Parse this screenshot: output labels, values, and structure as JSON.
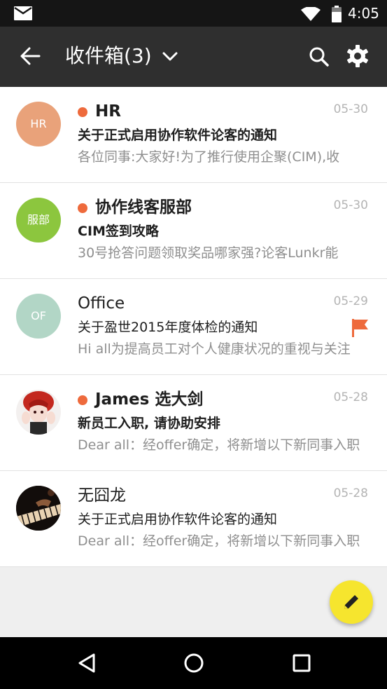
{
  "status_bar": {
    "time": "4:05",
    "icons": [
      "mail-icon",
      "wifi-icon",
      "battery-icon"
    ]
  },
  "app_bar": {
    "title": "收件箱(3)",
    "icons": [
      "back-arrow-icon",
      "chevron-down-icon",
      "search-icon",
      "gear-icon"
    ]
  },
  "emails": [
    {
      "avatar_text": "HR",
      "avatar_color": "#e9a27a",
      "unread": true,
      "sender": "HR",
      "date": "05-30",
      "subject": "关于正式启用协作软件论客的通知",
      "preview": "各位同事:大家好!为了推行使用企聚(CIM),收",
      "flagged": false
    },
    {
      "avatar_text": "服部",
      "avatar_color": "#8cc63e",
      "unread": true,
      "sender": "协作线客服部",
      "date": "05-30",
      "subject": "CIM签到攻略",
      "preview": "30号抢答问题领取奖品哪家强?论客Lunkr能",
      "flagged": false
    },
    {
      "avatar_text": "OF",
      "avatar_color": "#b2d6c6",
      "unread": false,
      "sender": "Office",
      "date": "05-29",
      "subject": "关于盈世2015年度体检的通知",
      "preview": "Hi all为提高员工对个人健康状况的重视与关注",
      "flagged": true,
      "flag_color": "#ee6a3c"
    },
    {
      "avatar_text": "",
      "avatar_image": "anime-character-photo",
      "unread": true,
      "sender": "James 选大剑",
      "date": "05-28",
      "subject": "新员工入职, 请协助安排",
      "preview": "Dear all：经offer确定，将新增以下新同事入职",
      "flagged": false
    },
    {
      "avatar_text": "",
      "avatar_image": "piano-photo",
      "unread": false,
      "sender": "无囧龙",
      "date": "05-28",
      "subject": "关于正式启用协作软件论客的通知",
      "preview": "Dear all：经offer确定，将新增以下新同事入职",
      "flagged": false
    }
  ],
  "fab": {
    "icon": "pencil-icon",
    "color": "#f6e52e"
  },
  "nav_bar": {
    "icons": [
      "back-triangle-icon",
      "home-circle-icon",
      "recents-square-icon"
    ]
  },
  "colors": {
    "unread_dot": "#ee6a3c",
    "app_bar": "#2f2f2f",
    "status_bar": "#151515"
  }
}
